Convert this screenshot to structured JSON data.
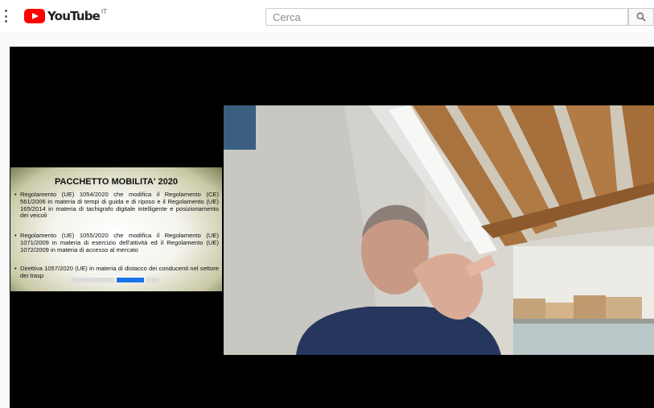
{
  "header": {
    "logo_text": "YouTube",
    "country": "IT",
    "search_placeholder": "Cerca",
    "icons": {
      "menu": "more-vertical-icon",
      "search": "search-icon"
    }
  },
  "slide": {
    "title": "PACCHETTO MOBILITA' 2020",
    "bullets": [
      "Regolamento (UE) 1054/2020 che modifica il Regolamento (CE) 561/2006 in materia di tempi di guida e di riposo e il Regolamento (UE) 165/2014 in materia di tachigrafo digitale intelligente e posizionamento dei veicoli",
      "Regolamento (UE) 1055/2020 che modifica il Regolamento (UE) 1071/2009 in materia di esercizio dell'attività ed il Regolamento (UE) 1072/2009 in materia di accesso al mercato",
      "Direttiva 1057/2020 (UE) in materia di distacco dei conducenti nel settore dei trasp"
    ]
  },
  "colors": {
    "brand": "#ff0000",
    "player_bg": "#000000"
  }
}
